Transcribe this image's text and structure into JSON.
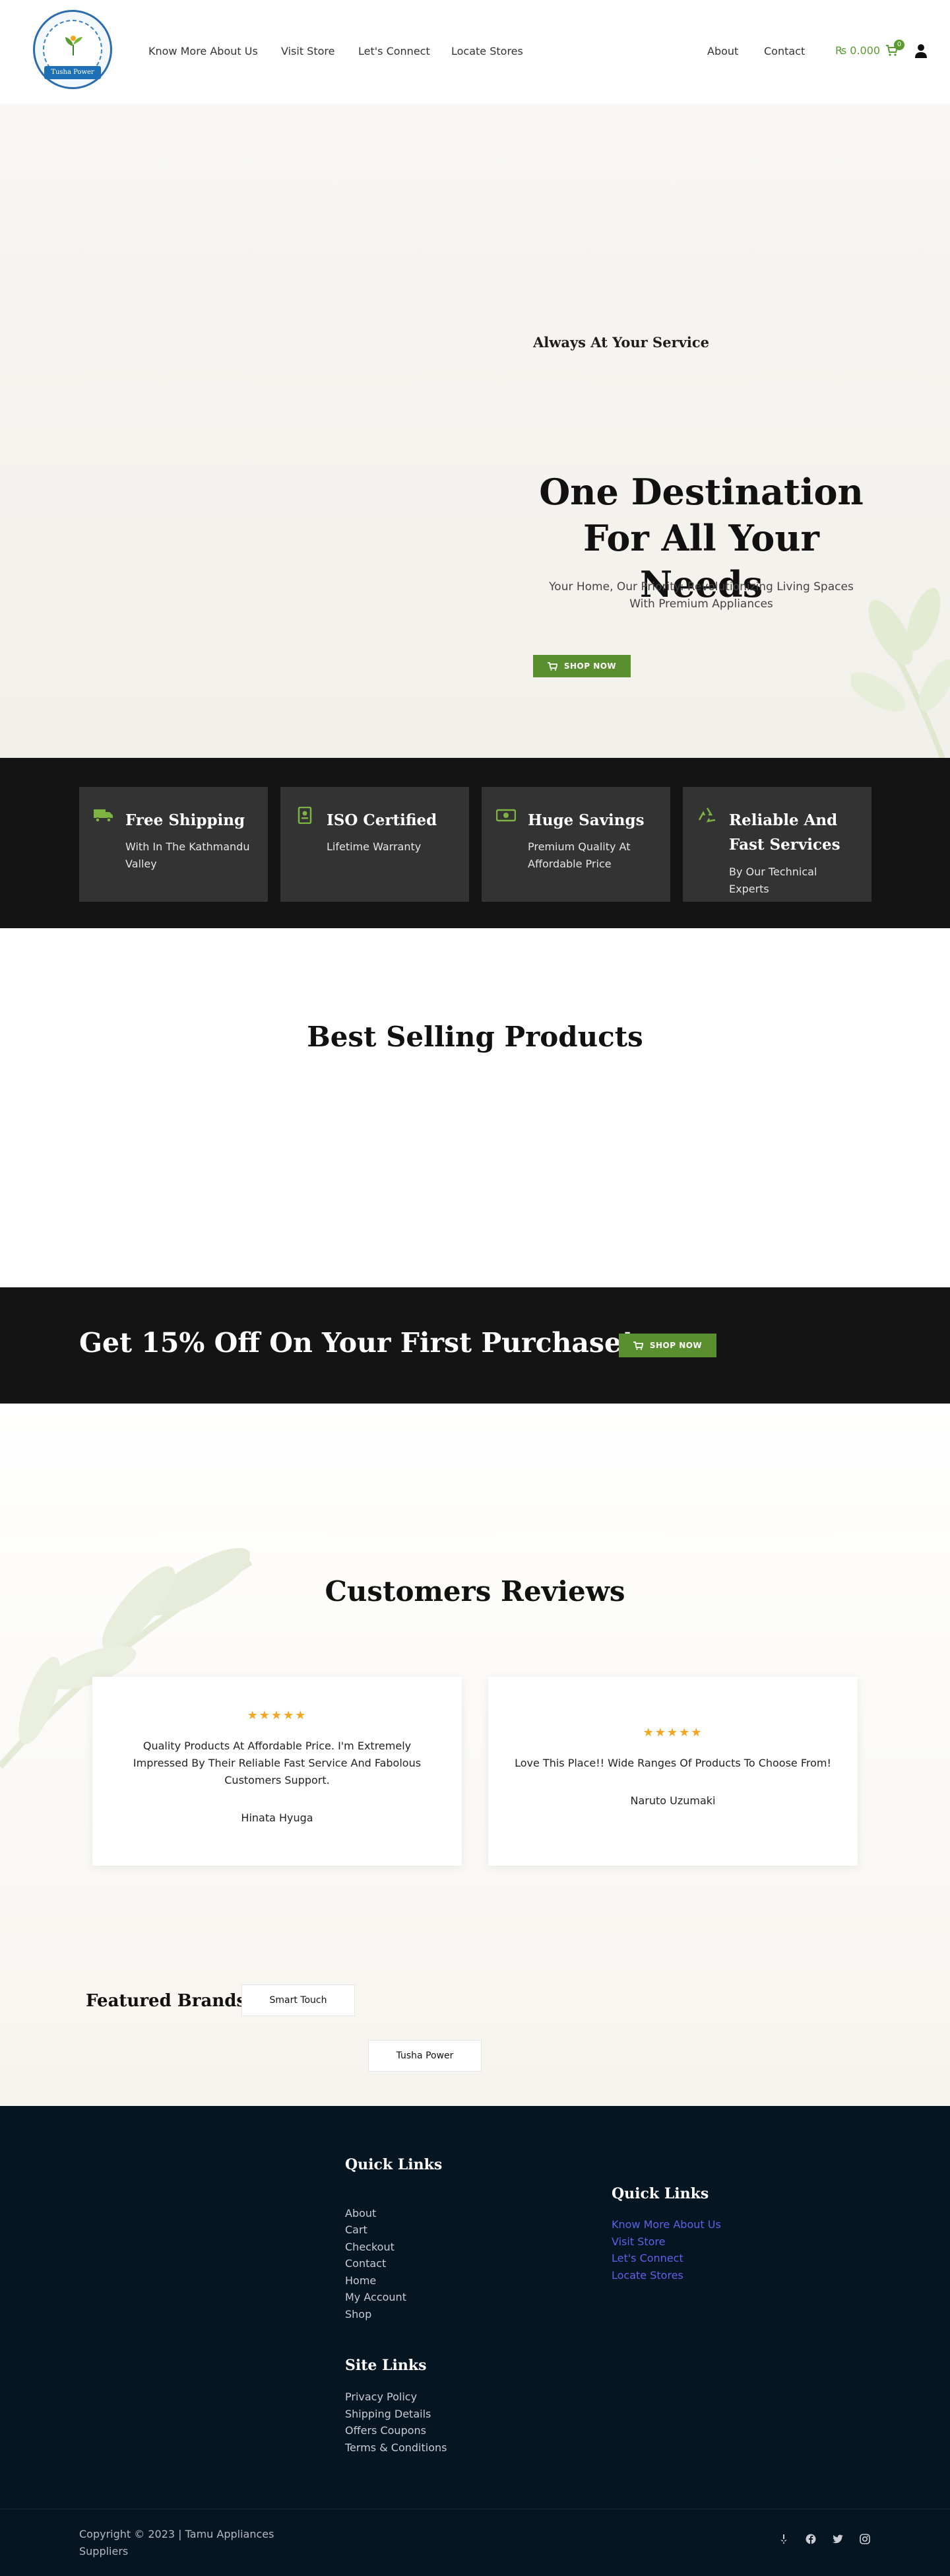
{
  "brand": {
    "logo_text": "Tusha Power",
    "accent_color": "#5a8f2f"
  },
  "header": {
    "nav_left": [
      "Know More About Us",
      "Visit Store",
      "Let's Connect",
      "Locate Stores"
    ],
    "nav_right": [
      "About",
      "Contact"
    ],
    "cart_amount": "₨ 0.000",
    "cart_count": "0"
  },
  "hero": {
    "kicker": "Always At Your Service",
    "title": "One Destination For All Your Needs",
    "subtitle": "Your Home, Our Priority: Revolutionizing Living Spaces With Premium Appliances",
    "cta": "SHOP NOW"
  },
  "features": [
    {
      "icon": "truck-icon",
      "title": "Free Shipping",
      "desc": "With In The Kathmandu Valley"
    },
    {
      "icon": "certificate-icon",
      "title": "ISO Certified",
      "desc": "Lifetime Warranty"
    },
    {
      "icon": "money-icon",
      "title": "Huge Savings",
      "desc": "Premium Quality At Affordable Price"
    },
    {
      "icon": "recycle-icon",
      "title": "Reliable And Fast Services",
      "desc": "By Our Technical Experts"
    }
  ],
  "best_selling": {
    "title": "Best Selling Products"
  },
  "promo": {
    "title": "Get 15% Off On Your First Purchase!",
    "cta": "SHOP NOW"
  },
  "reviews": {
    "title": "Customers Reviews",
    "items": [
      {
        "stars": "★★★★★",
        "text": "Quality Products At Affordable Price. I'm Extremely Impressed By Their Reliable Fast Service And Fabolous Customers Support.",
        "name": "Hinata Hyuga"
      },
      {
        "stars": "★★★★★",
        "text": "Love This Place!! Wide Ranges Of Products To Choose From!",
        "name": "Naruto Uzumaki"
      }
    ],
    "rating": 5
  },
  "brands": {
    "label": "Featured Brands:",
    "items": [
      "Smart Touch",
      "Tusha Power"
    ]
  },
  "footer": {
    "quick_links_title": "Quick Links",
    "quick_links": [
      "About",
      "Cart",
      "Checkout",
      "Contact",
      "Home",
      "My Account",
      "Shop"
    ],
    "site_links_title": "Site Links",
    "site_links": [
      "Privacy Policy",
      "Shipping Details",
      "Offers Coupons",
      "Terms & Conditions"
    ],
    "quick_links_2_title": "Quick Links",
    "quick_links_2": [
      "Know More About Us",
      "Visit Store",
      "Let's Connect",
      "Locate Stores"
    ],
    "copyright": "Copyright © 2023 | Tamu Appliances Suppliers",
    "social": [
      "yelp-icon",
      "facebook-icon",
      "twitter-icon",
      "instagram-icon"
    ]
  }
}
